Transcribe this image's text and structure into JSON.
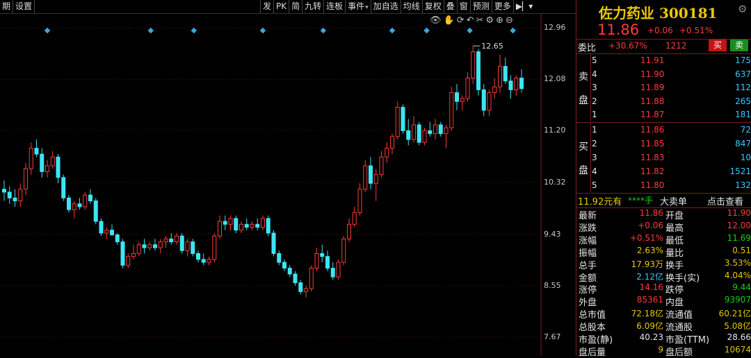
{
  "toolbar_left": [
    "期",
    "设置"
  ],
  "toolbar_right": [
    "发",
    "PK",
    "简",
    "九转",
    "连板",
    "事件",
    "加自选",
    "均线",
    "复权",
    "叠",
    "窗",
    "预测",
    "更多"
  ],
  "toolbar_dropdown_items": [
    "事件"
  ],
  "chart_icons": [
    "eye-icon",
    "hand-icon",
    "refresh-icon",
    "undo-icon",
    "scissors-icon",
    "settings-icon",
    "zoom-in-icon",
    "zoom-out-icon"
  ],
  "colors": {
    "up": "#ff3b3b",
    "down": "#3ce5f2",
    "grid": "#5a1010",
    "marker": "#3aa7e0"
  },
  "chart_data": {
    "type": "candlestick",
    "y_ticks": [
      "12.96",
      "12.08",
      "11.20",
      "10.32",
      "9.43",
      "8.55",
      "7.67"
    ],
    "ylim": [
      7.67,
      12.96
    ],
    "annotation": "12.65",
    "candles": [
      [
        10.2,
        10.35,
        10.0,
        10.15
      ],
      [
        10.15,
        10.25,
        9.95,
        10.05
      ],
      [
        10.05,
        10.2,
        9.9,
        10.0
      ],
      [
        10.0,
        10.3,
        9.9,
        10.2
      ],
      [
        10.2,
        10.65,
        10.1,
        10.55
      ],
      [
        10.55,
        11.0,
        10.45,
        10.9
      ],
      [
        10.9,
        11.05,
        10.75,
        10.8
      ],
      [
        10.8,
        10.9,
        10.4,
        10.5
      ],
      [
        10.5,
        10.7,
        10.4,
        10.6
      ],
      [
        10.6,
        10.85,
        10.55,
        10.75
      ],
      [
        10.75,
        10.8,
        10.3,
        10.4
      ],
      [
        10.4,
        10.45,
        10.0,
        10.05
      ],
      [
        10.05,
        10.1,
        9.8,
        9.85
      ],
      [
        9.85,
        10.0,
        9.7,
        9.95
      ],
      [
        9.95,
        10.05,
        9.85,
        9.9
      ],
      [
        9.9,
        10.15,
        9.85,
        10.1
      ],
      [
        10.1,
        10.2,
        9.95,
        10.0
      ],
      [
        10.0,
        10.05,
        9.6,
        9.65
      ],
      [
        9.65,
        9.7,
        9.4,
        9.45
      ],
      [
        9.45,
        9.55,
        9.35,
        9.5
      ],
      [
        9.5,
        9.6,
        9.4,
        9.42
      ],
      [
        9.42,
        9.45,
        9.25,
        9.3
      ],
      [
        9.3,
        9.35,
        8.85,
        8.9
      ],
      [
        8.9,
        9.1,
        8.85,
        9.05
      ],
      [
        9.05,
        9.25,
        9.0,
        9.1
      ],
      [
        9.1,
        9.3,
        9.05,
        9.25
      ],
      [
        9.25,
        9.35,
        9.1,
        9.2
      ],
      [
        9.2,
        9.3,
        9.15,
        9.25
      ],
      [
        9.25,
        9.35,
        9.15,
        9.2
      ],
      [
        9.2,
        9.35,
        9.1,
        9.3
      ],
      [
        9.3,
        9.4,
        9.2,
        9.35
      ],
      [
        9.35,
        9.45,
        9.25,
        9.3
      ],
      [
        9.3,
        9.45,
        9.25,
        9.4
      ],
      [
        9.4,
        9.45,
        9.1,
        9.15
      ],
      [
        9.15,
        9.35,
        9.05,
        9.3
      ],
      [
        9.3,
        9.35,
        9.05,
        9.1
      ],
      [
        9.1,
        9.15,
        8.95,
        9.0
      ],
      [
        9.0,
        9.1,
        8.9,
        8.95
      ],
      [
        8.95,
        9.05,
        8.9,
        9.0
      ],
      [
        9.0,
        9.45,
        8.95,
        9.4
      ],
      [
        9.4,
        9.75,
        9.35,
        9.65
      ],
      [
        9.65,
        9.75,
        9.5,
        9.6
      ],
      [
        9.6,
        9.75,
        9.5,
        9.7
      ],
      [
        9.7,
        9.75,
        9.45,
        9.5
      ],
      [
        9.5,
        9.65,
        9.45,
        9.6
      ],
      [
        9.6,
        9.7,
        9.5,
        9.55
      ],
      [
        9.55,
        9.65,
        9.5,
        9.6
      ],
      [
        9.6,
        9.7,
        9.5,
        9.55
      ],
      [
        9.55,
        9.75,
        9.5,
        9.7
      ],
      [
        9.7,
        9.75,
        9.4,
        9.45
      ],
      [
        9.45,
        9.5,
        9.05,
        9.1
      ],
      [
        9.1,
        9.15,
        8.9,
        8.95
      ],
      [
        8.95,
        9.0,
        8.8,
        8.85
      ],
      [
        8.85,
        8.9,
        8.7,
        8.75
      ],
      [
        8.75,
        8.8,
        8.55,
        8.6
      ],
      [
        8.6,
        8.65,
        8.4,
        8.45
      ],
      [
        8.45,
        8.55,
        8.35,
        8.5
      ],
      [
        8.5,
        8.9,
        8.45,
        8.85
      ],
      [
        8.85,
        9.2,
        8.8,
        9.1
      ],
      [
        9.1,
        9.25,
        8.95,
        9.05
      ],
      [
        9.05,
        9.15,
        8.8,
        8.85
      ],
      [
        8.85,
        8.95,
        8.65,
        8.7
      ],
      [
        8.7,
        9.0,
        8.65,
        8.95
      ],
      [
        8.95,
        9.4,
        8.9,
        9.35
      ],
      [
        9.35,
        9.7,
        9.3,
        9.6
      ],
      [
        9.6,
        9.9,
        9.55,
        9.8
      ],
      [
        9.8,
        10.3,
        9.75,
        10.2
      ],
      [
        10.2,
        10.7,
        10.15,
        10.6
      ],
      [
        10.6,
        10.75,
        10.2,
        10.3
      ],
      [
        10.3,
        10.55,
        10.0,
        10.45
      ],
      [
        10.45,
        10.85,
        10.4,
        10.75
      ],
      [
        10.75,
        11.0,
        10.65,
        10.9
      ],
      [
        10.9,
        11.15,
        10.8,
        11.1
      ],
      [
        11.1,
        11.7,
        11.05,
        11.6
      ],
      [
        11.6,
        11.65,
        11.15,
        11.2
      ],
      [
        11.2,
        11.4,
        10.95,
        11.05
      ],
      [
        11.05,
        11.45,
        11.0,
        11.3
      ],
      [
        11.3,
        11.35,
        10.95,
        11.0
      ],
      [
        11.0,
        11.25,
        10.95,
        11.2
      ],
      [
        11.2,
        11.35,
        11.1,
        11.15
      ],
      [
        11.15,
        11.4,
        11.05,
        11.3
      ],
      [
        11.3,
        11.35,
        11.1,
        11.15
      ],
      [
        11.15,
        11.3,
        10.9,
        11.25
      ],
      [
        11.25,
        11.95,
        11.2,
        11.85
      ],
      [
        11.85,
        12.0,
        11.55,
        11.7
      ],
      [
        11.7,
        11.8,
        11.55,
        11.75
      ],
      [
        11.75,
        12.2,
        11.7,
        12.1
      ],
      [
        12.1,
        12.65,
        12.0,
        12.55
      ],
      [
        12.55,
        12.6,
        11.8,
        11.9
      ],
      [
        11.9,
        12.0,
        11.45,
        11.55
      ],
      [
        11.55,
        11.9,
        11.45,
        11.85
      ],
      [
        11.85,
        12.1,
        11.75,
        11.95
      ],
      [
        11.95,
        12.5,
        11.85,
        12.3
      ],
      [
        12.3,
        12.45,
        12.0,
        12.05
      ],
      [
        12.05,
        12.15,
        11.75,
        11.9
      ],
      [
        11.9,
        12.15,
        11.8,
        12.1
      ],
      [
        12.1,
        12.25,
        11.85,
        11.92
      ]
    ]
  },
  "markers_at": [
    5,
    17,
    22,
    30,
    37,
    45,
    49,
    54,
    59
  ],
  "header": {
    "title": "佐力药业 300181",
    "price": "11.86",
    "change": "+0.06",
    "change_pct": "+0.51%"
  },
  "weibi": {
    "label": "委比",
    "pct": "+30.67%",
    "diff": "1212",
    "buy_btn": "买",
    "sell_btn": "卖"
  },
  "sell_side_label": [
    "卖",
    "盘"
  ],
  "buy_side_label": [
    "买",
    "盘"
  ],
  "asks": [
    {
      "level": "5",
      "price": "11.91",
      "vol": "175"
    },
    {
      "level": "4",
      "price": "11.90",
      "vol": "637"
    },
    {
      "level": "3",
      "price": "11.89",
      "vol": "112"
    },
    {
      "level": "2",
      "price": "11.88",
      "vol": "265"
    },
    {
      "level": "1",
      "price": "11.87",
      "vol": "181"
    }
  ],
  "bids": [
    {
      "level": "1",
      "price": "11.86",
      "vol": "72"
    },
    {
      "level": "2",
      "price": "11.85",
      "vol": "847"
    },
    {
      "level": "3",
      "price": "11.83",
      "vol": "10"
    },
    {
      "level": "4",
      "price": "11.82",
      "vol": "1521"
    },
    {
      "level": "5",
      "price": "11.80",
      "vol": "132"
    }
  ],
  "bigorder": {
    "price": "11.92元有",
    "stars": "****手",
    "label": "大卖单",
    "link": "点击查看"
  },
  "stats": [
    {
      "l1": "最新",
      "v1": "11.86",
      "c1": "red",
      "l2": "开盘",
      "v2": "11.90",
      "c2": "red"
    },
    {
      "l1": "涨跌",
      "v1": "+0.06",
      "c1": "red",
      "l2": "最高",
      "v2": "12.00",
      "c2": "red"
    },
    {
      "l1": "涨幅",
      "v1": "+0.51%",
      "c1": "red",
      "l2": "最低",
      "v2": "11.69",
      "c2": "green"
    },
    {
      "l1": "振幅",
      "v1": "2.63%",
      "c1": "yellow",
      "l2": "量比",
      "v2": "0.51",
      "c2": "yellow"
    },
    {
      "l1": "总手",
      "v1": "17.93万",
      "c1": "yellow",
      "l2": "换手",
      "v2": "3.53%",
      "c2": "yellow"
    },
    {
      "l1": "金额",
      "v1": "2.12亿",
      "c1": "cyan",
      "l2": "换手(实)",
      "v2": "4.04%",
      "c2": "yellow"
    },
    {
      "l1": "涨停",
      "v1": "14.16",
      "c1": "red",
      "l2": "跌停",
      "v2": "9.44",
      "c2": "green"
    },
    {
      "l1": "外盘",
      "v1": "85361",
      "c1": "red",
      "l2": "内盘",
      "v2": "93907",
      "c2": "green"
    },
    {
      "l1": "总市值",
      "v1": "72.18亿",
      "c1": "yellow",
      "l2": "流通值",
      "v2": "60.21亿",
      "c2": "yellow"
    },
    {
      "l1": "总股本",
      "v1": "6.09亿",
      "c1": "yellow",
      "l2": "流通股",
      "v2": "5.08亿",
      "c2": "yellow"
    },
    {
      "l1": "市盈(静)",
      "v1": "40.23",
      "c1": "white",
      "l2": "市盈(TTM)",
      "v2": "28.66",
      "c2": "white"
    },
    {
      "l1": "盘后量",
      "v1": "9",
      "c1": "yellow",
      "l2": "盘后额",
      "v2": "10674",
      "c2": "yellow"
    }
  ]
}
